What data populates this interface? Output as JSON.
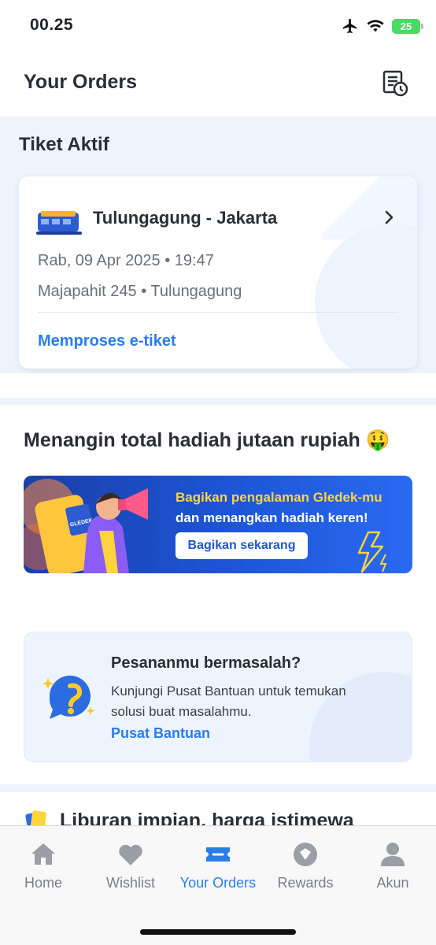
{
  "status_bar": {
    "time": "00.25",
    "battery": "25",
    "icons": [
      "airplane-icon",
      "wifi-icon",
      "battery-icon"
    ]
  },
  "header": {
    "title": "Your Orders",
    "history_icon": "order-history-icon"
  },
  "active_tickets": {
    "section_title": "Tiket Aktif",
    "ticket": {
      "route": "Tulungagung - Jakarta",
      "date_time": "Rab, 09 Apr 2025 • 19:47",
      "train_info": "Majapahit 245 • Tulungagung",
      "status": "Memproses e-tiket"
    }
  },
  "promo": {
    "title": "Menangin total hadiah jutaan rupiah 🤑",
    "banner_line1": "Bagikan pengalaman Gledek-mu",
    "banner_line2": "dan menangkan hadiah keren!",
    "cta": "Bagikan sekarang",
    "phone_brand": "GLEDEK"
  },
  "help": {
    "title": "Pesananmu bermasalah?",
    "description": "Kunjungi Pusat Bantuan untuk temukan solusi buat masalahmu.",
    "link": "Pusat Bantuan"
  },
  "next_section": {
    "title": "Liburan impian, harga istimewa"
  },
  "bottom_nav": {
    "items": [
      {
        "label": "Home",
        "icon": "home-icon",
        "active": false
      },
      {
        "label": "Wishlist",
        "icon": "heart-icon",
        "active": false
      },
      {
        "label": "Your Orders",
        "icon": "ticket-icon",
        "active": true
      },
      {
        "label": "Rewards",
        "icon": "rewards-icon",
        "active": false
      },
      {
        "label": "Akun",
        "icon": "person-icon",
        "active": false
      }
    ]
  },
  "colors": {
    "accent": "#2b7de9",
    "section_bg": "#eef4fd",
    "promo_yellow": "#ffd43b"
  }
}
